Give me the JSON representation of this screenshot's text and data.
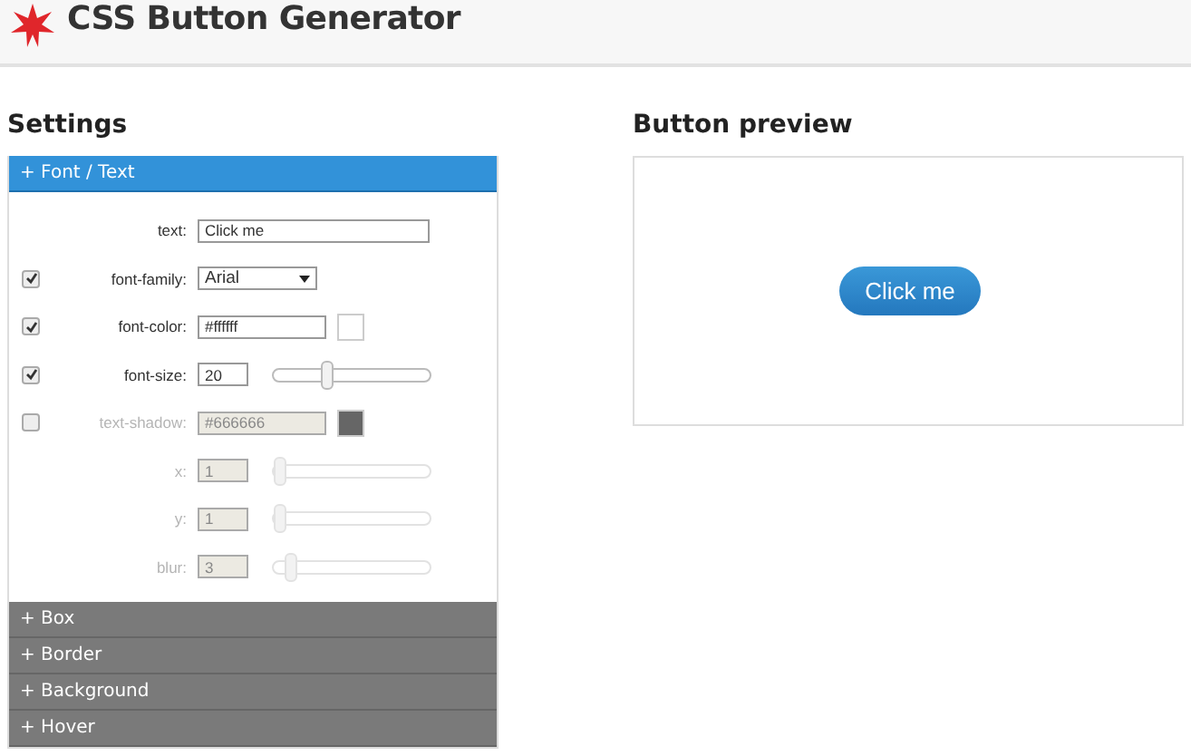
{
  "header": {
    "title": "CSS Button Generator"
  },
  "settings": {
    "title": "Settings",
    "sections": [
      {
        "label": "+ Font / Text",
        "expanded": true,
        "rows": [
          {
            "kind": "text",
            "label": "text:",
            "value": "Click me",
            "disabled": false
          },
          {
            "kind": "select",
            "label": "font-family:",
            "value": "Arial",
            "checked": true,
            "disabled": false
          },
          {
            "kind": "color",
            "label": "font-color:",
            "value": "#ffffff",
            "color": "#ffffff",
            "checked": true,
            "disabled": false
          },
          {
            "kind": "slider",
            "label": "font-size:",
            "value": "20",
            "level": 0.33,
            "checked": true,
            "disabled": false
          },
          {
            "kind": "color",
            "label": "text-shadow:",
            "value": "#666666",
            "color": "#666666",
            "checked": false,
            "disabled": true
          },
          {
            "kind": "slider",
            "label": "x:",
            "value": "1",
            "level": 0.0,
            "disabled": true
          },
          {
            "kind": "slider",
            "label": "y:",
            "value": "1",
            "level": 0.0,
            "disabled": true
          },
          {
            "kind": "slider",
            "label": "blur:",
            "value": "3",
            "level": 0.08,
            "disabled": true
          }
        ]
      },
      {
        "label": "+ Box",
        "expanded": false
      },
      {
        "label": "+ Border",
        "expanded": false
      },
      {
        "label": "+ Background",
        "expanded": false
      },
      {
        "label": "+ Hover",
        "expanded": false
      }
    ]
  },
  "preview": {
    "title": "Button preview",
    "button_label": "Click me"
  }
}
